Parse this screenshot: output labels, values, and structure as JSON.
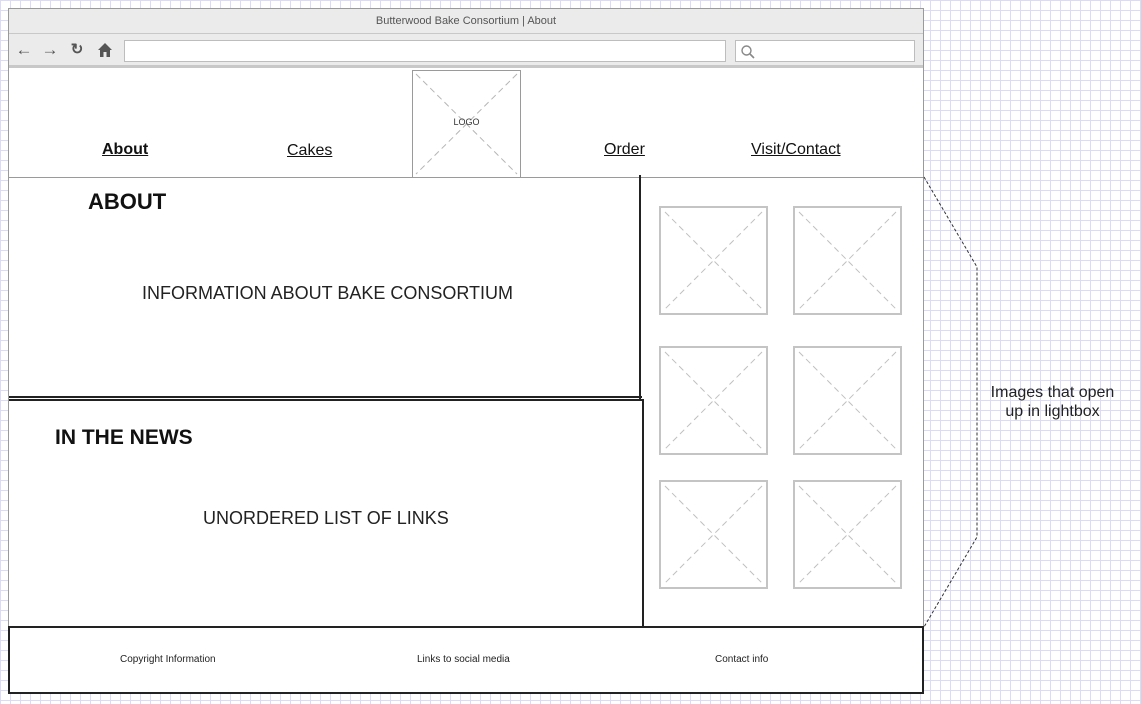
{
  "browser": {
    "title": "Butterwood Bake Consortium | About",
    "icons": [
      "arrow-left-icon",
      "arrow-right-icon",
      "reload-icon",
      "home-icon",
      "search-icon"
    ]
  },
  "header": {
    "nav": {
      "about": "About",
      "cakes": "Cakes",
      "order": "Order",
      "visit": "Visit/Contact"
    },
    "logo_label": "LOGO"
  },
  "about": {
    "title": "ABOUT",
    "body": "INFORMATION ABOUT BAKE CONSORTIUM"
  },
  "news": {
    "title": "IN THE NEWS",
    "body": "UNORDERED LIST OF LINKS"
  },
  "gallery": {
    "image_count": 6
  },
  "footer": {
    "copyright": "Copyright Information",
    "social": "Links to social media",
    "contact": "Contact info"
  },
  "annotation": {
    "line1": "Images that open",
    "line2": "up in lightbox"
  }
}
